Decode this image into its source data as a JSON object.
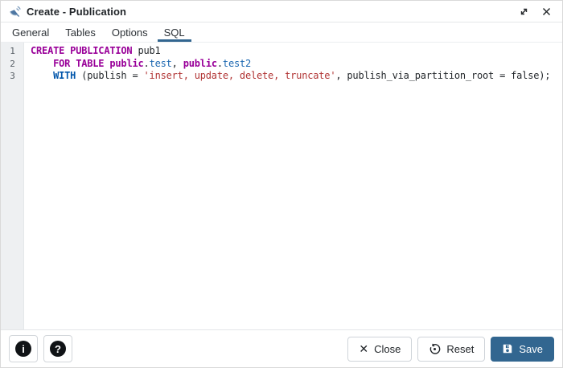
{
  "window": {
    "title": "Create - Publication",
    "icon": "publication-icon",
    "controls": {
      "maximize": "expand",
      "close": "close"
    }
  },
  "tabs": [
    {
      "label": "General",
      "active": false
    },
    {
      "label": "Tables",
      "active": false
    },
    {
      "label": "Options",
      "active": false
    },
    {
      "label": "SQL",
      "active": true
    }
  ],
  "editor": {
    "language": "sql",
    "lines": [
      {
        "number": "1",
        "tokens": [
          {
            "t": "keyword",
            "v": "CREATE PUBLICATION"
          },
          {
            "t": "plain",
            "v": " pub1"
          }
        ]
      },
      {
        "number": "2",
        "tokens": [
          {
            "t": "plain",
            "v": "    "
          },
          {
            "t": "keyword",
            "v": "FOR TABLE"
          },
          {
            "t": "plain",
            "v": " "
          },
          {
            "t": "keyword",
            "v": "public"
          },
          {
            "t": "plain",
            "v": "."
          },
          {
            "t": "name",
            "v": "test"
          },
          {
            "t": "plain",
            "v": ", "
          },
          {
            "t": "keyword",
            "v": "public"
          },
          {
            "t": "plain",
            "v": "."
          },
          {
            "t": "name",
            "v": "test2"
          }
        ]
      },
      {
        "number": "3",
        "tokens": [
          {
            "t": "plain",
            "v": "    "
          },
          {
            "t": "kwblue",
            "v": "WITH"
          },
          {
            "t": "plain",
            "v": " (publish = "
          },
          {
            "t": "string",
            "v": "'insert, update, delete, truncate'"
          },
          {
            "t": "plain",
            "v": ", publish_via_partition_root = false);"
          }
        ]
      }
    ]
  },
  "footer": {
    "info_glyph": "i",
    "help_glyph": "?",
    "close_label": "Close",
    "reset_label": "Reset",
    "save_label": "Save"
  },
  "colors": {
    "accent": "#326690",
    "keyword": "#990099",
    "identifier_blue": "#0055aa",
    "string_red": "#b13434",
    "gutter_bg": "#eef0f2"
  }
}
